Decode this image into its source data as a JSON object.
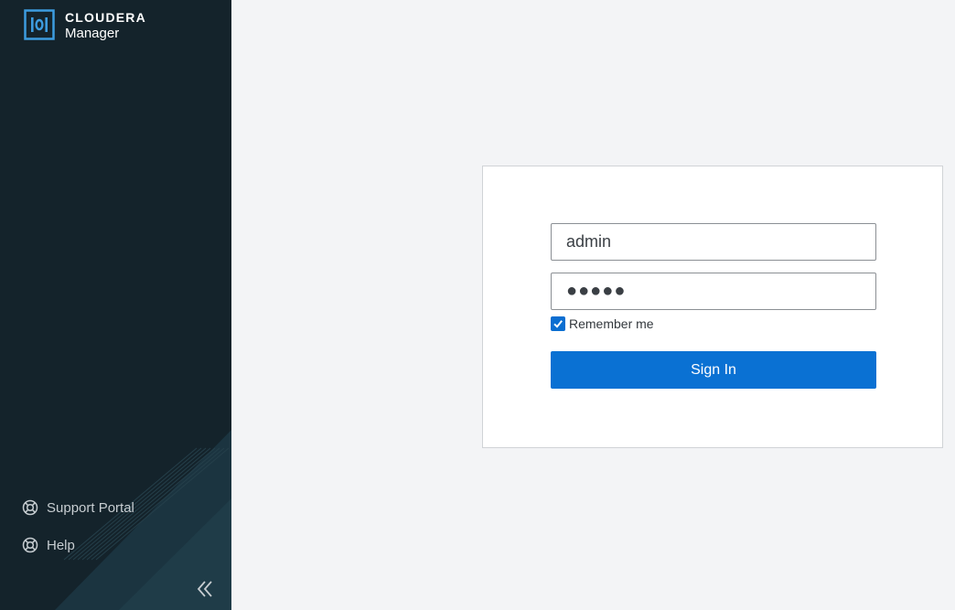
{
  "brand": {
    "name": "CLOUDERA",
    "product": "Manager",
    "logo_color": "#3d9ce0"
  },
  "sidebar": {
    "background": "#14232b",
    "links": [
      {
        "label": "Support Portal",
        "icon": "lifebuoy-icon"
      },
      {
        "label": "Help",
        "icon": "lifebuoy-icon"
      }
    ],
    "collapse_icon": "double-chevron-left-icon"
  },
  "login": {
    "username_value": "admin",
    "password_masked": "●●●●●",
    "remember_label": "Remember me",
    "remember_checked": true,
    "signin_label": "Sign In",
    "accent_color": "#0a71d3"
  }
}
